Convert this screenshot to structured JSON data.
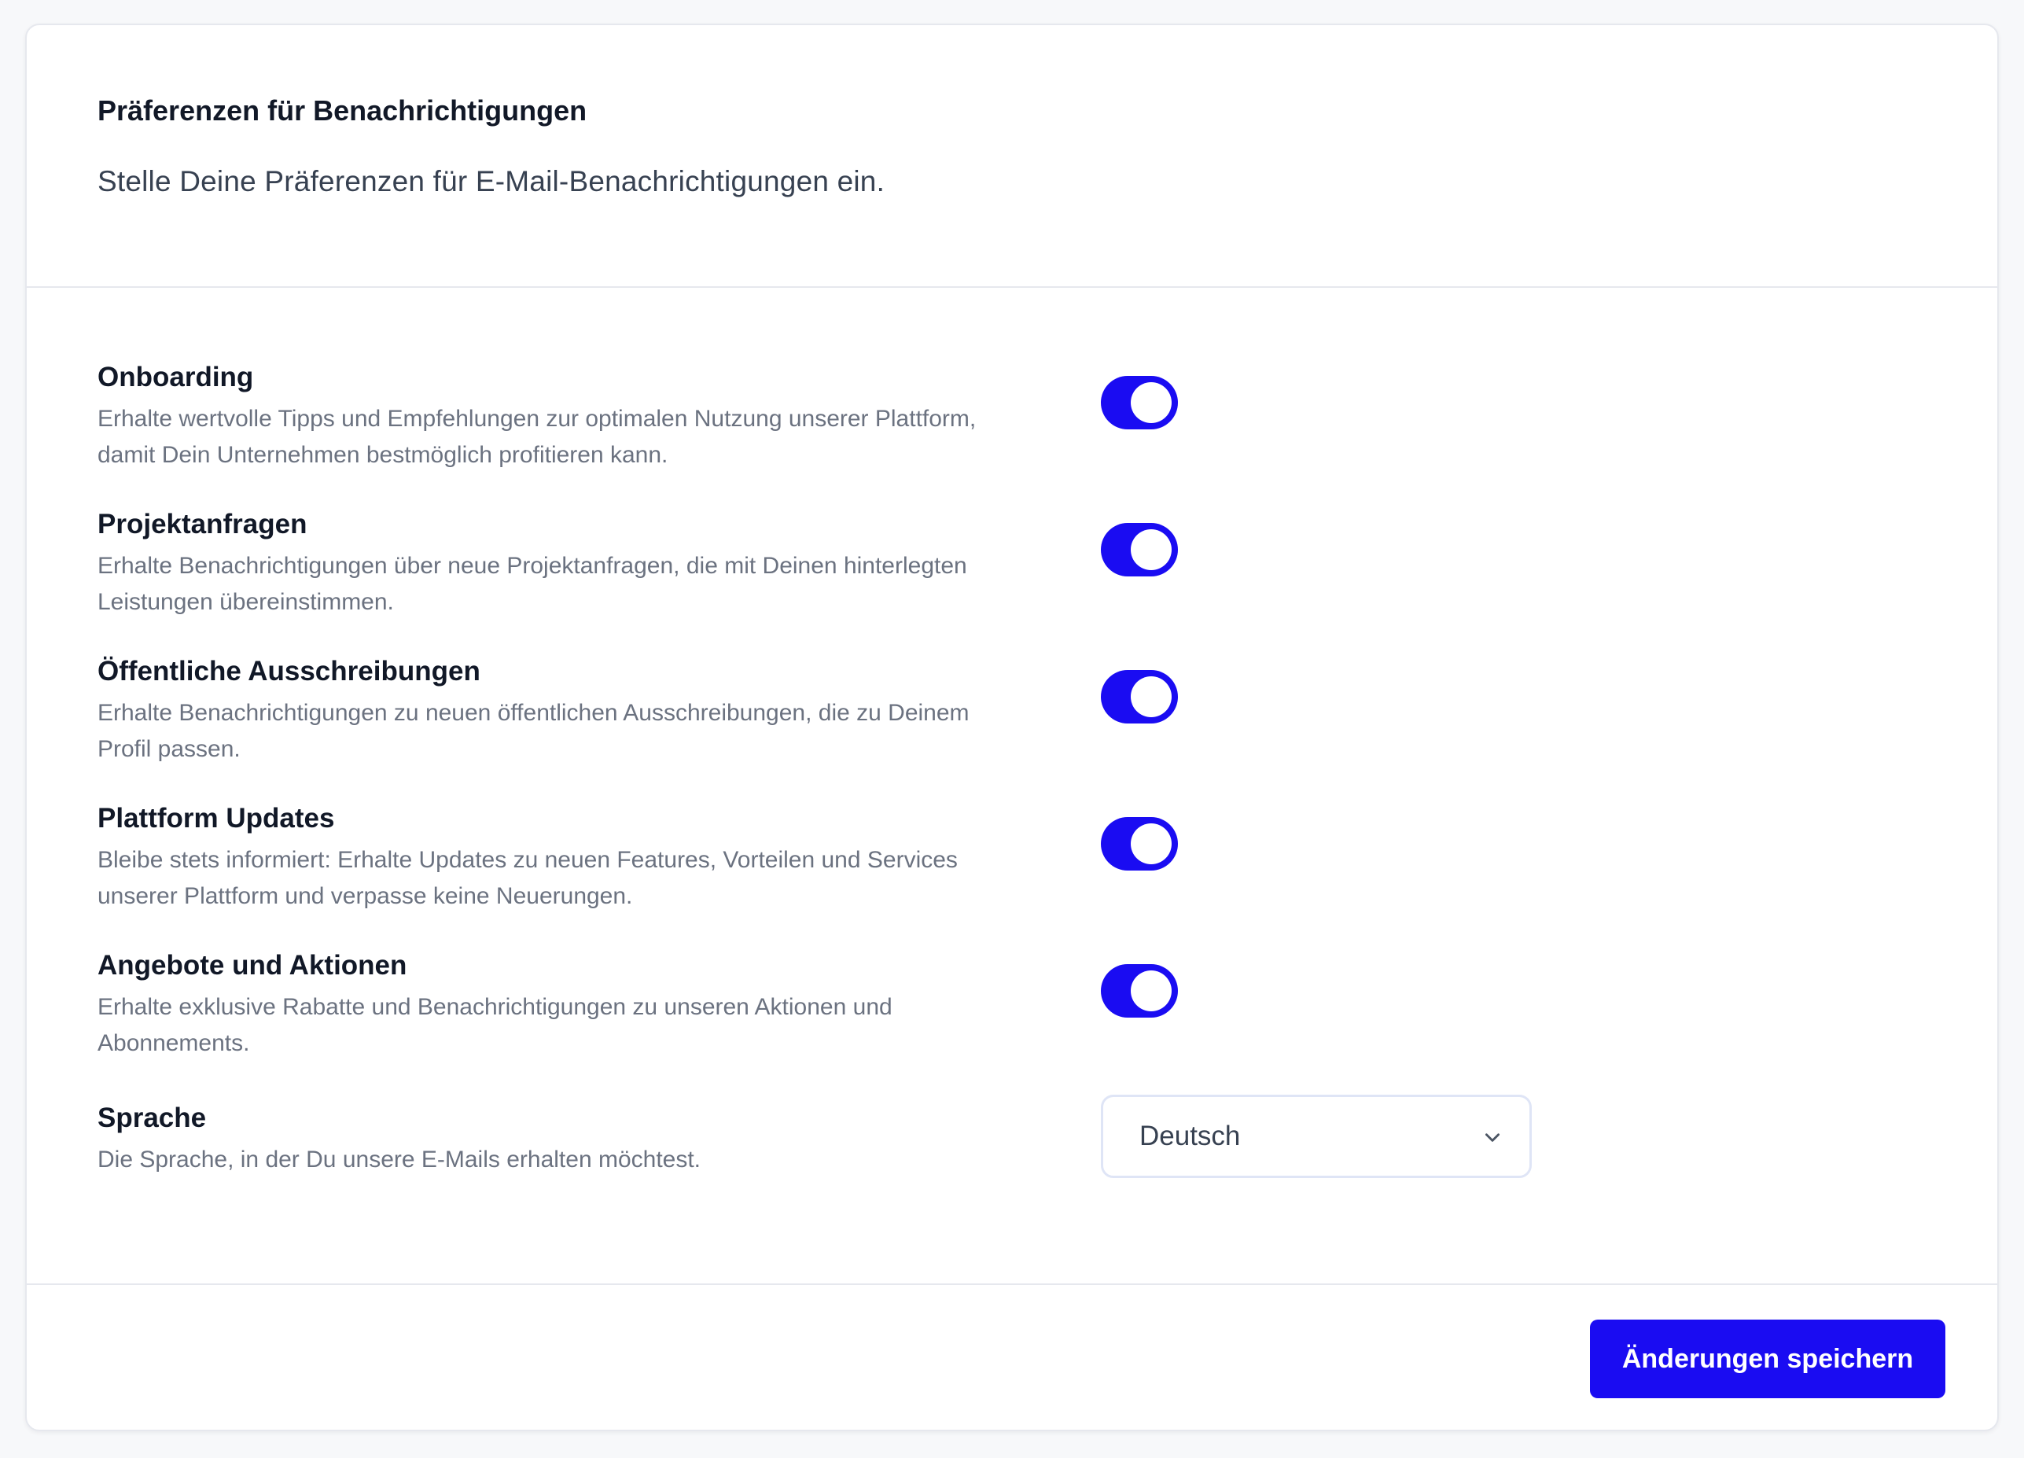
{
  "header": {
    "title": "Präferenzen für Benachrichtigungen",
    "subtitle": "Stelle Deine Präferenzen für E-Mail-Benachrichtigungen ein."
  },
  "preferences": [
    {
      "title": "Onboarding",
      "description": "Erhalte wertvolle Tipps und Empfehlungen zur optimalen Nutzung unserer Plattform, damit Dein Unternehmen bestmöglich profitieren kann.",
      "enabled": true
    },
    {
      "title": "Projektanfragen",
      "description": "Erhalte Benachrichtigungen über neue Projektanfragen, die mit Deinen hinterlegten Leistungen übereinstimmen.",
      "enabled": true
    },
    {
      "title": "Öffentliche Ausschreibungen",
      "description": "Erhalte Benachrichtigungen zu neuen öffentlichen Ausschreibungen, die zu Deinem Profil passen.",
      "enabled": true
    },
    {
      "title": "Plattform Updates",
      "description": "Bleibe stets informiert: Erhalte Updates zu neuen Features, Vorteilen und Services unserer Plattform und verpasse keine Neuerungen.",
      "enabled": true
    },
    {
      "title": "Angebote und Aktionen",
      "description": "Erhalte exklusive Rabatte und Benachrichtigungen zu unseren Aktionen und Abonnements.",
      "enabled": true
    }
  ],
  "language": {
    "title": "Sprache",
    "description": "Die Sprache, in der Du unsere E-Mails erhalten möchtest.",
    "selected": "Deutsch"
  },
  "footer": {
    "save_label": "Änderungen speichern"
  },
  "colors": {
    "accent": "#1a0cf2",
    "border": "#e6e8ee",
    "muted_text": "#6b7280"
  }
}
